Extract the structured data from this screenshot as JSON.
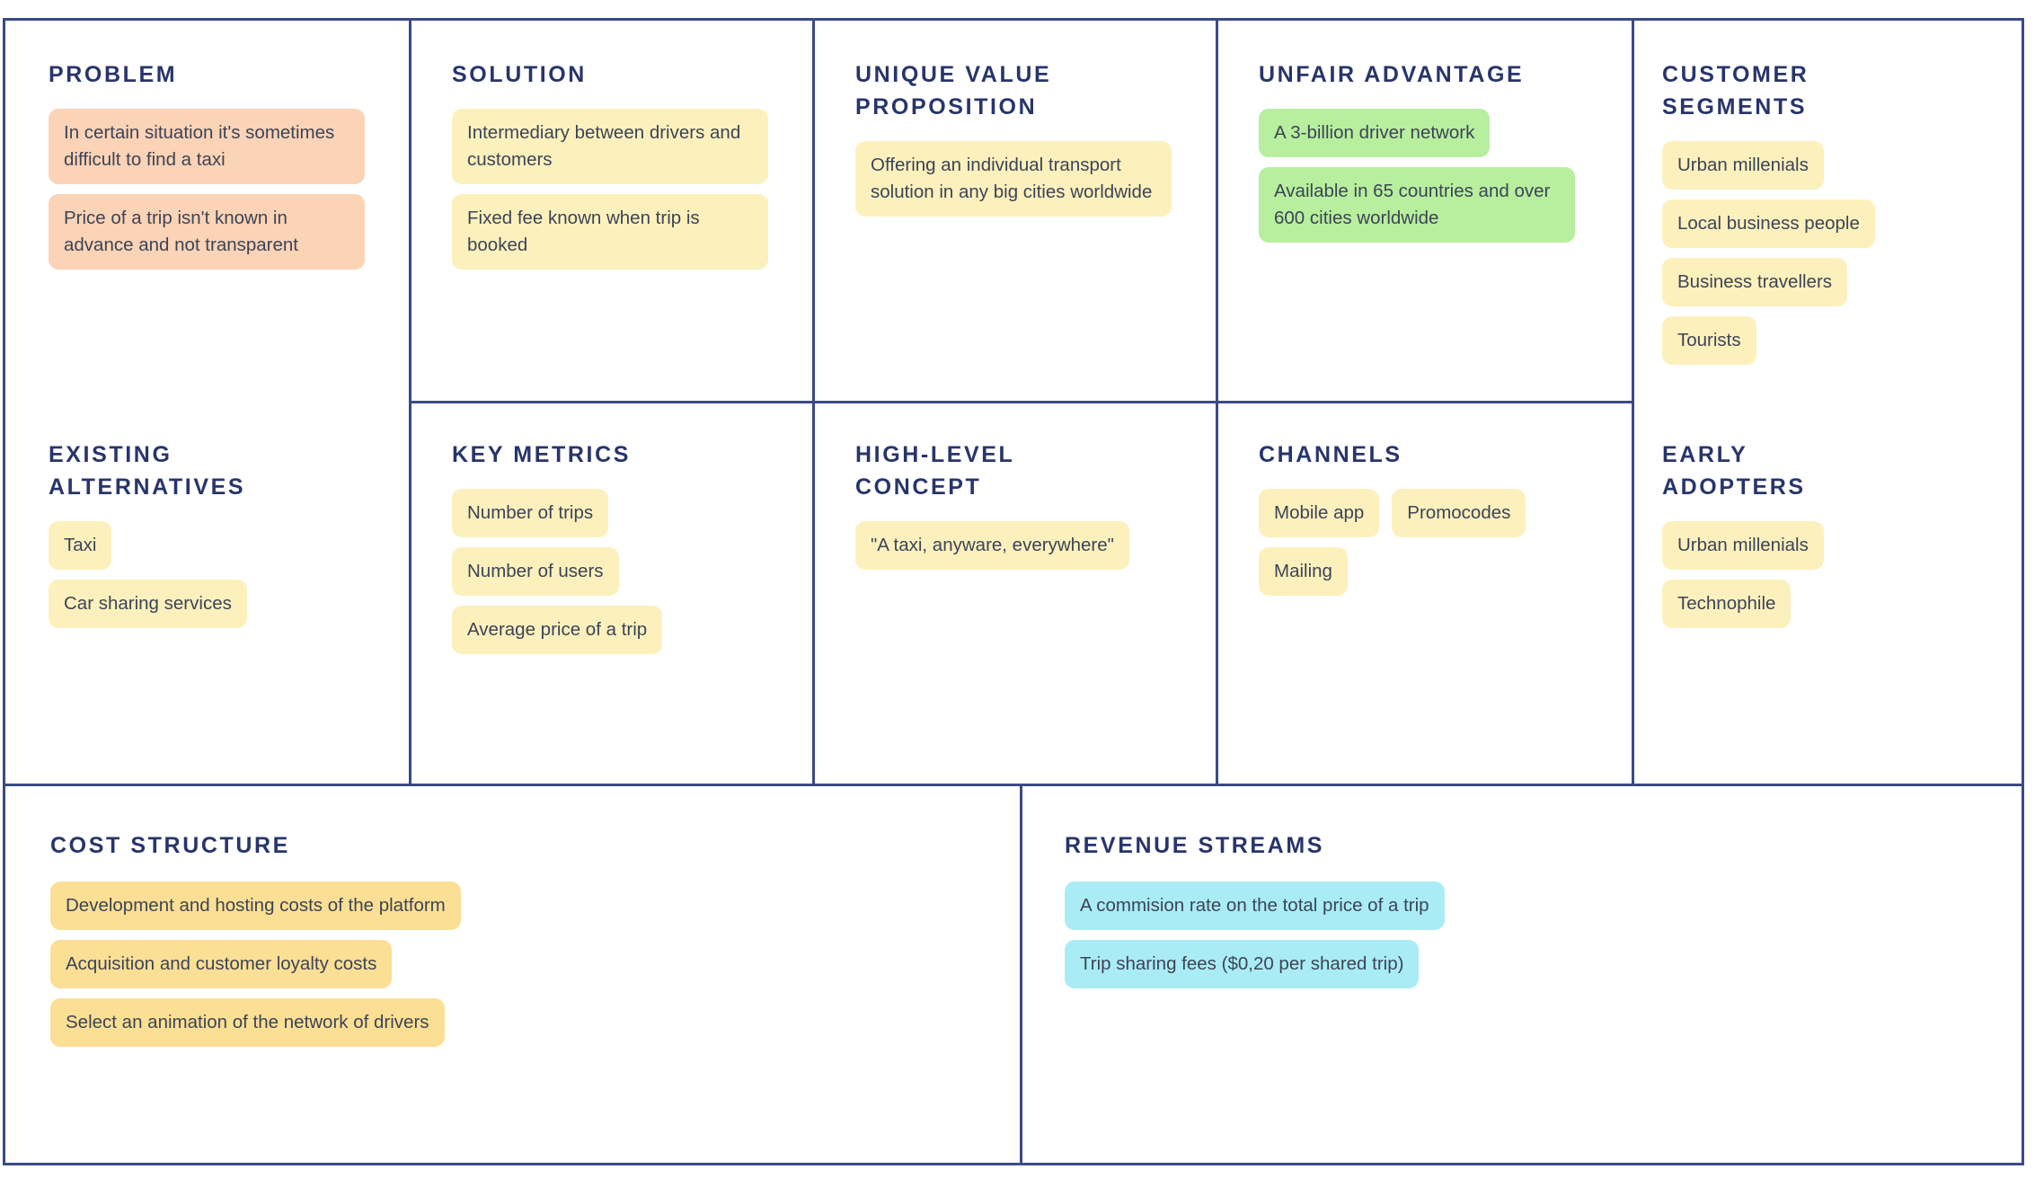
{
  "colors": {
    "border": "#3b4a86",
    "title": "#28356b",
    "card_text": "#3d4456",
    "peach": "#fbd3b6",
    "yellow": "#fcf1bd",
    "green": "#b7ef9e",
    "gold": "#fbdf95",
    "blue": "#a9ecf5"
  },
  "sections": {
    "problem": {
      "title": "PROBLEM",
      "cards": [
        "In certain situation it's sometimes difficult to find a taxi",
        "Price of a trip isn't known in advance and not transparent"
      ]
    },
    "solution": {
      "title": "SOLUTION",
      "cards": [
        "Intermediary between drivers and customers",
        "Fixed fee known when trip is booked"
      ]
    },
    "uvp": {
      "title": "UNIQUE VALUE\nPROPOSITION",
      "cards": [
        "Offering an individual transport solution in any big cities worldwide"
      ]
    },
    "unfair_advantage": {
      "title": "UNFAIR ADVANTAGE",
      "cards": [
        "A 3-billion driver network",
        "Available in 65 countries and over 600 cities worldwide"
      ]
    },
    "customer_segments": {
      "title": "CUSTOMER\nSEGMENTS",
      "cards": [
        "Urban millenials",
        "Local business people",
        "Business travellers",
        "Tourists"
      ]
    },
    "existing_alternatives": {
      "title": "EXISTING\nALTERNATIVES",
      "cards": [
        "Taxi",
        "Car sharing services"
      ]
    },
    "key_metrics": {
      "title": "KEY METRICS",
      "cards": [
        "Number of trips",
        "Number of users",
        "Average price of a trip"
      ]
    },
    "high_level_concept": {
      "title": "HIGH-LEVEL\nCONCEPT",
      "cards": [
        "\"A taxi, anyware, everywhere\""
      ]
    },
    "channels": {
      "title": "CHANNELS",
      "cards": [
        "Mobile app",
        "Promocodes",
        "Mailing"
      ]
    },
    "early_adopters": {
      "title": "EARLY\nADOPTERS",
      "cards": [
        "Urban millenials",
        "Technophile"
      ]
    },
    "cost_structure": {
      "title": "COST STRUCTURE",
      "cards": [
        "Development and hosting costs of the platform",
        "Acquisition and customer loyalty costs",
        "Select an animation of the network of drivers"
      ]
    },
    "revenue_streams": {
      "title": "REVENUE STREAMS",
      "cards": [
        "A commision rate on the total price of a trip",
        "Trip sharing fees ($0,20 per shared trip)"
      ]
    }
  }
}
